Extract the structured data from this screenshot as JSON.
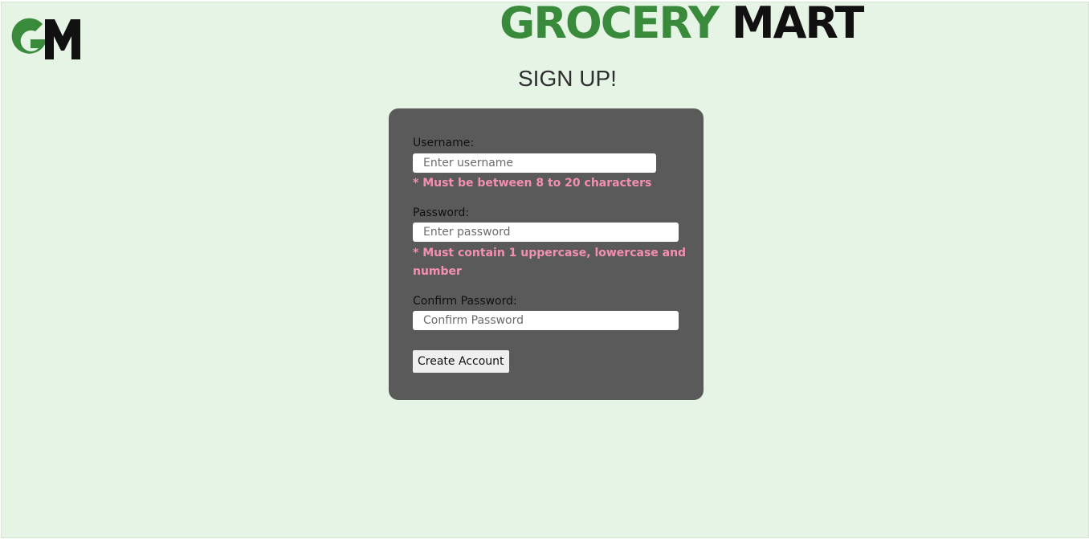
{
  "brand": {
    "logo_text": "GM",
    "name_part1": "GROCERY",
    "name_part2": "MART"
  },
  "page_title": "SIGN UP!",
  "form": {
    "username": {
      "label": "Username:",
      "placeholder": "Enter username",
      "value": "",
      "hint": "* Must be between 8 to 20 characters"
    },
    "password": {
      "label": "Password:",
      "placeholder": "Enter password",
      "value": "",
      "hint_line1": "* Must contain 1 uppercase, lowercase and",
      "hint_line2": "number"
    },
    "confirm": {
      "label": "Confirm Password:",
      "placeholder": "Confirm Password",
      "value": ""
    },
    "submit_label": "Create Account"
  },
  "colors": {
    "background": "#e6f4e6",
    "brand_green": "#3a8a3c",
    "brand_dark": "#111111",
    "card": "#5a5a5a",
    "hint": "#f58fb0"
  }
}
